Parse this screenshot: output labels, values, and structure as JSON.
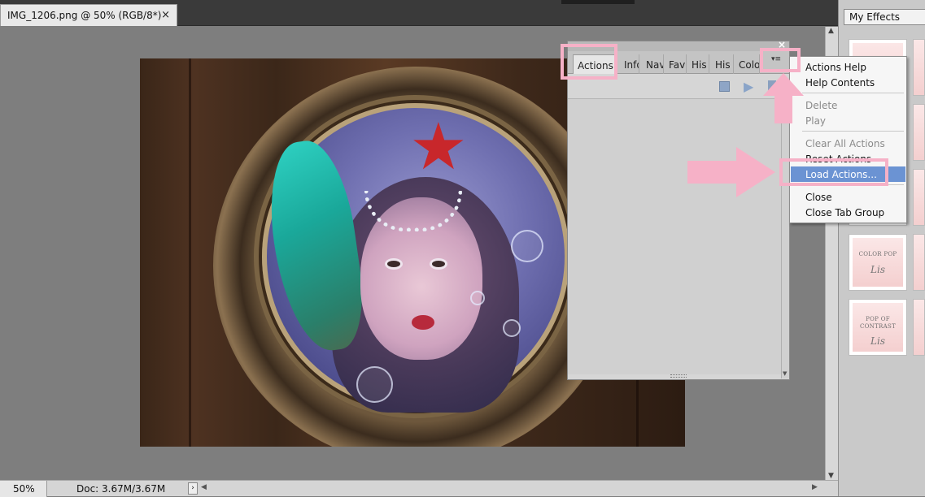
{
  "document": {
    "tab_title": "IMG_1206.png @ 50% (RGB/8*)",
    "close_glyph": "×"
  },
  "status": {
    "zoom": "50%",
    "doc_info": "Doc: 3.67M/3.67M",
    "arrow": "›"
  },
  "effects_panel": {
    "dropdown": "My Effects",
    "thumbnails": [
      {
        "line1": "",
        "line2": "",
        "sig": ""
      },
      {
        "line1": "",
        "line2": "",
        "sig": ""
      },
      {
        "line1": "",
        "line2": "",
        "sig": ""
      },
      {
        "line1": "COLOR POP",
        "line2": "",
        "sig": "Lis"
      },
      {
        "line1": "POP OF",
        "line2": "CONTRAST",
        "sig": "Lis"
      }
    ]
  },
  "actions_panel": {
    "close_glyph": "×",
    "tabs": [
      "Actions",
      "Info",
      "Nav",
      "Fav",
      "His",
      "His",
      "Colo"
    ],
    "menu_button_glyph": "▾≡"
  },
  "panel_menu": {
    "items": [
      {
        "label": "Actions Help",
        "enabled": true
      },
      {
        "label": "Help Contents",
        "enabled": true
      },
      {
        "label": "Delete",
        "enabled": false
      },
      {
        "label": "Play",
        "enabled": false
      },
      {
        "label": "Clear All Actions",
        "enabled": false
      },
      {
        "label": "Reset Actions",
        "enabled": true
      },
      {
        "label": "Load Actions...",
        "enabled": true,
        "selected": true
      },
      {
        "label": "Close",
        "enabled": true
      },
      {
        "label": "Close Tab Group",
        "enabled": true
      }
    ]
  },
  "colors": {
    "highlight_pink": "#f6b1c7",
    "menu_selection": "#6b93d3"
  }
}
